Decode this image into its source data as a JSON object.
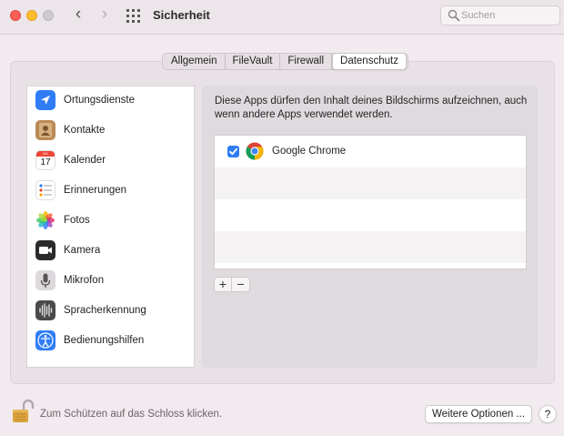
{
  "window": {
    "title": "Sicherheit",
    "back_glyph": "‹",
    "forward_glyph": "›"
  },
  "search": {
    "placeholder": "Suchen",
    "icon": "magnifier-icon"
  },
  "tabs": [
    {
      "label": "Allgemein",
      "active": false
    },
    {
      "label": "FileVault",
      "active": false
    },
    {
      "label": "Firewall",
      "active": false
    },
    {
      "label": "Datenschutz",
      "active": true
    }
  ],
  "sidebar": {
    "items": [
      {
        "label": "Ortungsdienste",
        "icon": "location-arrow-icon",
        "color": "#2f7cf6"
      },
      {
        "label": "Kontakte",
        "icon": "contacts-book-icon",
        "color": "#b98b58"
      },
      {
        "label": "Kalender",
        "icon": "calendar-icon",
        "color": "#ffffff",
        "month": "JUL",
        "day": "17"
      },
      {
        "label": "Erinnerungen",
        "icon": "reminders-list-icon",
        "color": "#ffffff"
      },
      {
        "label": "Fotos",
        "icon": "photos-flower-icon",
        "color": "#ffffff"
      },
      {
        "label": "Kamera",
        "icon": "camera-icon",
        "color": "#2b2b2b"
      },
      {
        "label": "Mikrofon",
        "icon": "microphone-icon",
        "color": "#dcd8dc"
      },
      {
        "label": "Spracherkennung",
        "icon": "waveform-icon",
        "color": "#4a4a4a"
      },
      {
        "label": "Bedienungshilfen",
        "icon": "accessibility-icon",
        "color": "#2f7cf6"
      }
    ]
  },
  "content": {
    "description": "Diese Apps dürfen den Inhalt deines Bildschirms aufzeichnen, auch wenn andere Apps verwendet werden.",
    "apps": [
      {
        "name": "Google Chrome",
        "checked": true,
        "icon": "chrome-icon"
      }
    ],
    "add_label": "+",
    "remove_label": "−"
  },
  "footer": {
    "lock_text": "Zum Schützen auf das Schloss klicken.",
    "more_button": "Weitere Optionen ...",
    "help_button": "?"
  },
  "colors": {
    "accent": "#2f7cf6",
    "window_bg": "#f1ebef"
  }
}
